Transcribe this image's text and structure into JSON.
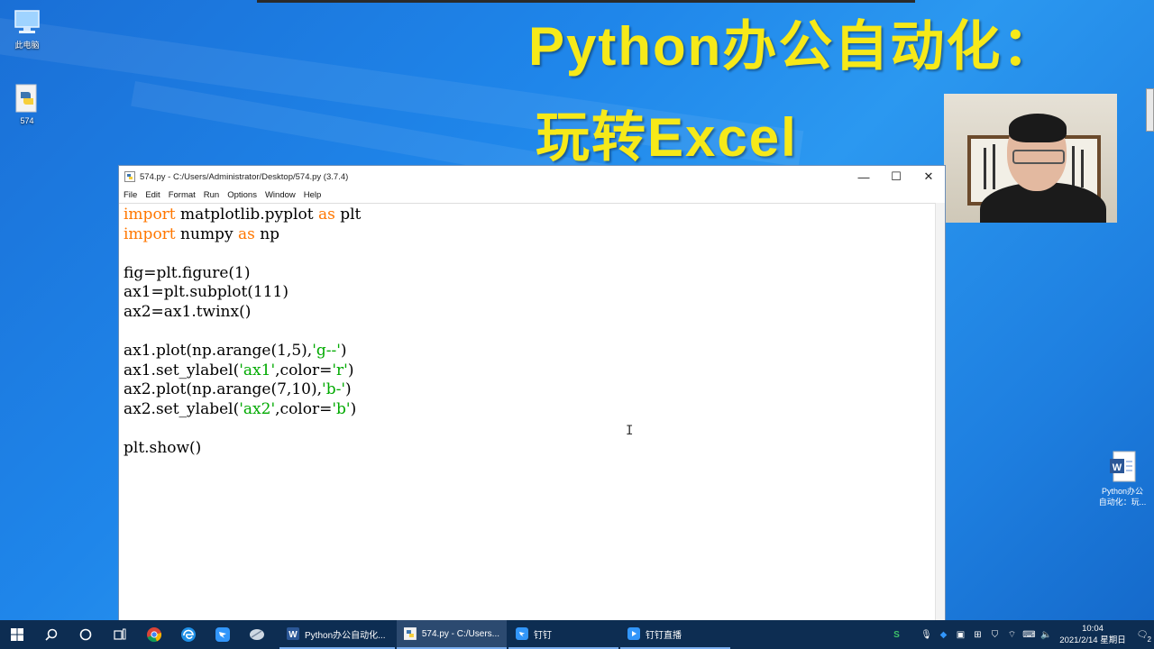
{
  "desktop": {
    "icons": [
      {
        "label": "此电脑",
        "icon": "computer-icon"
      },
      {
        "label": "574",
        "icon": "python-file-icon"
      }
    ],
    "right_icon": {
      "label_line1": "Python办公",
      "label_line2": "自动化：玩...",
      "icon": "word-doc-icon"
    }
  },
  "banner": {
    "line1": "Python办公自动化：",
    "line2": "玩转Excel",
    "color": "#f6e919"
  },
  "window": {
    "title": "574.py - C:/Users/Administrator/Desktop/574.py (3.7.4)",
    "menu": [
      "File",
      "Edit",
      "Format",
      "Run",
      "Options",
      "Window",
      "Help"
    ]
  },
  "code": {
    "l1_kw1": "import",
    "l1_mid": " matplotlib.pyplot ",
    "l1_kw2": "as",
    "l1_end": " plt",
    "l2_kw1": "import",
    "l2_mid": " numpy ",
    "l2_kw2": "as",
    "l2_end": " np",
    "l4": "fig=plt.figure(1)",
    "l5": "ax1=plt.subplot(111)",
    "l6": "ax2=ax1.twinx()",
    "l8_a": "ax1.plot(np.arange(1,5),",
    "l8_s": "'g--'",
    "l8_b": ")",
    "l9_a": "ax1.set_ylabel(",
    "l9_s1": "'ax1'",
    "l9_b": ",color=",
    "l9_s2": "'r'",
    "l9_c": ")",
    "l10_a": "ax2.plot(np.arange(7,10),",
    "l10_s": "'b-'",
    "l10_b": ")",
    "l11_a": "ax2.set_ylabel(",
    "l11_s1": "'ax2'",
    "l11_b": ",color=",
    "l11_s2": "'b'",
    "l11_c": ")",
    "l13": "plt.show()"
  },
  "taskbar": {
    "apps": [
      {
        "label": "Python办公自动化...",
        "icon": "word-icon"
      },
      {
        "label": "574.py - C:/Users...",
        "icon": "idle-icon"
      },
      {
        "label": "钉钉",
        "icon": "dingtalk-icon"
      },
      {
        "label": "钉钉直播",
        "icon": "dingtalk-live-icon"
      }
    ],
    "clock_time": "10:04",
    "clock_date": "2021/2/14 星期日",
    "notification_count": "2"
  }
}
